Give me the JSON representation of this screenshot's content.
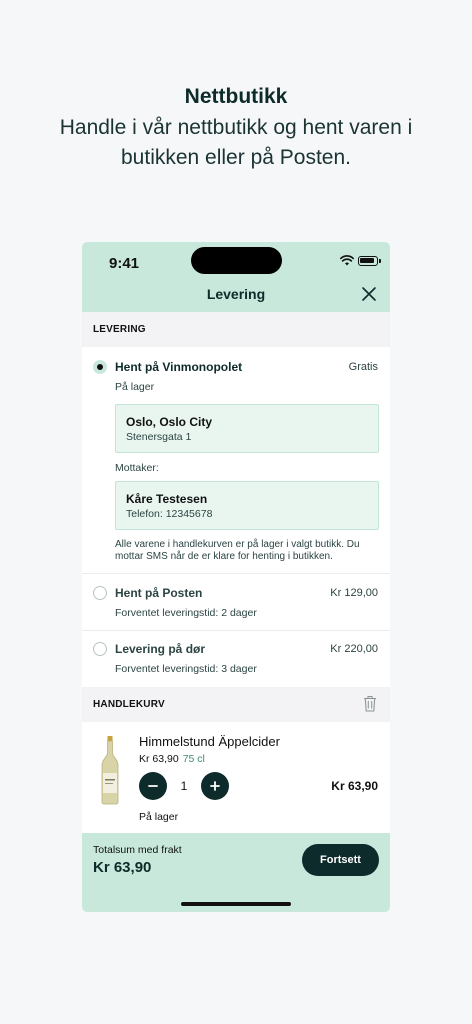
{
  "hero": {
    "title": "Nettbutikk",
    "subtitle_line1": "Handle i vår nettbutikk og hent varen i",
    "subtitle_line2": "butikken eller på Posten."
  },
  "status_bar": {
    "time": "9:41"
  },
  "header": {
    "title": "Levering"
  },
  "delivery": {
    "section_label": "LEVERING",
    "options": [
      {
        "title": "Hent på Vinmonopolet",
        "price": "Gratis",
        "subtitle": "På lager",
        "selected": true,
        "store": {
          "name": "Oslo, Oslo City",
          "address": "Stenersgata 1"
        },
        "recipient_label": "Mottaker:",
        "recipient": {
          "name": "Kåre Testesen",
          "phone": "Telefon: 12345678"
        },
        "note_line1": "Alle varene i handlekurven er på lager i valgt butikk. Du",
        "note_line2": "mottar SMS når de er klare for henting i butikken."
      },
      {
        "title": "Hent på Posten",
        "price": "Kr 129,00",
        "subtitle": "Forventet leveringstid: 2 dager",
        "selected": false
      },
      {
        "title": "Levering på dør",
        "price": "Kr 220,00",
        "subtitle": "Forventet leveringstid: 3 dager",
        "selected": false
      }
    ]
  },
  "cart": {
    "section_label": "HANDLEKURV",
    "items": [
      {
        "name": "Himmelstund Äppelcider",
        "price": "Kr 63,90",
        "volume": "75 cl",
        "quantity": "1",
        "line_total": "Kr 63,90",
        "stock": "På lager"
      }
    ]
  },
  "footer": {
    "total_label": "Totalsum med frakt",
    "total_value": "Kr 63,90",
    "continue_label": "Fortsett"
  },
  "colors": {
    "accent_mint": "#c8e8dc",
    "dark_green": "#0d2b2a",
    "box_fill": "#e9f6f0"
  },
  "icons": [
    "wifi-icon",
    "battery-icon",
    "close-icon",
    "trash-icon",
    "minus-icon",
    "plus-icon",
    "radio-selected",
    "radio-unselected",
    "bottle-image"
  ]
}
